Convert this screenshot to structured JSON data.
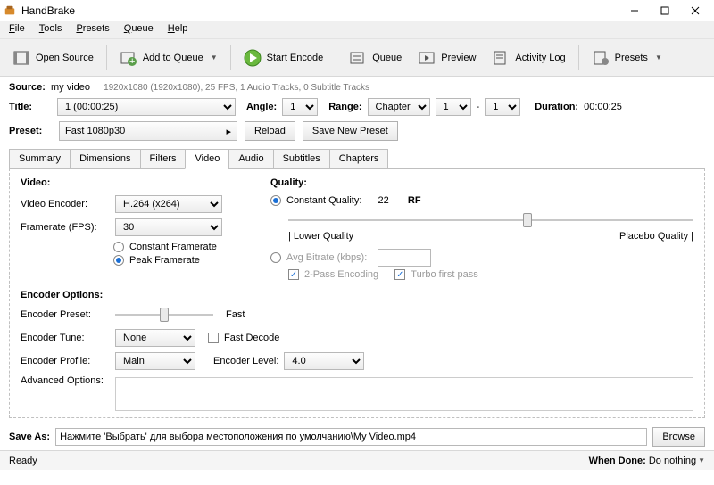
{
  "titlebar": {
    "title": "HandBrake"
  },
  "menu": {
    "file": "File",
    "tools": "Tools",
    "presets": "Presets",
    "queue": "Queue",
    "help": "Help"
  },
  "toolbar": {
    "open_source": "Open Source",
    "add_queue": "Add to Queue",
    "start_encode": "Start Encode",
    "queue": "Queue",
    "preview": "Preview",
    "activity_log": "Activity Log",
    "presets": "Presets"
  },
  "source": {
    "label": "Source:",
    "name": "my video",
    "meta": "1920x1080 (1920x1080), 25 FPS, 1 Audio Tracks, 0 Subtitle Tracks"
  },
  "title": {
    "label": "Title:",
    "value": "1  (00:00:25)",
    "angle_label": "Angle:",
    "angle": "1",
    "range_label": "Range:",
    "range_type": "Chapters",
    "from": "1",
    "to": "1",
    "duration_label": "Duration:",
    "duration": "00:00:25"
  },
  "preset": {
    "label": "Preset:",
    "value": "Fast 1080p30",
    "reload": "Reload",
    "save_new": "Save New Preset"
  },
  "tabs": [
    "Summary",
    "Dimensions",
    "Filters",
    "Video",
    "Audio",
    "Subtitles",
    "Chapters"
  ],
  "video": {
    "heading": "Video:",
    "encoder_label": "Video Encoder:",
    "encoder": "H.264 (x264)",
    "framerate_label": "Framerate (FPS):",
    "framerate": "30",
    "cfr": "Constant Framerate",
    "pfr": "Peak Framerate",
    "quality_heading": "Quality:",
    "cq_label": "Constant Quality:",
    "cq_value": "22",
    "cq_unit": "RF",
    "lower": "| Lower Quality",
    "placebo": "Placebo Quality |",
    "avg_label": "Avg Bitrate (kbps):",
    "twopass": "2-Pass Encoding",
    "turbo": "Turbo first pass",
    "enc_opts": "Encoder Options:",
    "enc_preset_label": "Encoder Preset:",
    "enc_preset_value": "Fast",
    "enc_tune_label": "Encoder Tune:",
    "enc_tune": "None",
    "fast_decode": "Fast Decode",
    "enc_profile_label": "Encoder Profile:",
    "enc_profile": "Main",
    "enc_level_label": "Encoder Level:",
    "enc_level": "4.0",
    "adv_label": "Advanced Options:"
  },
  "save": {
    "label": "Save As:",
    "value": "Нажмите 'Выбрать' для выбора местоположения по умолчанию\\My Video.mp4",
    "browse": "Browse"
  },
  "status": {
    "ready": "Ready",
    "when_done_label": "When Done:",
    "when_done": "Do nothing"
  }
}
